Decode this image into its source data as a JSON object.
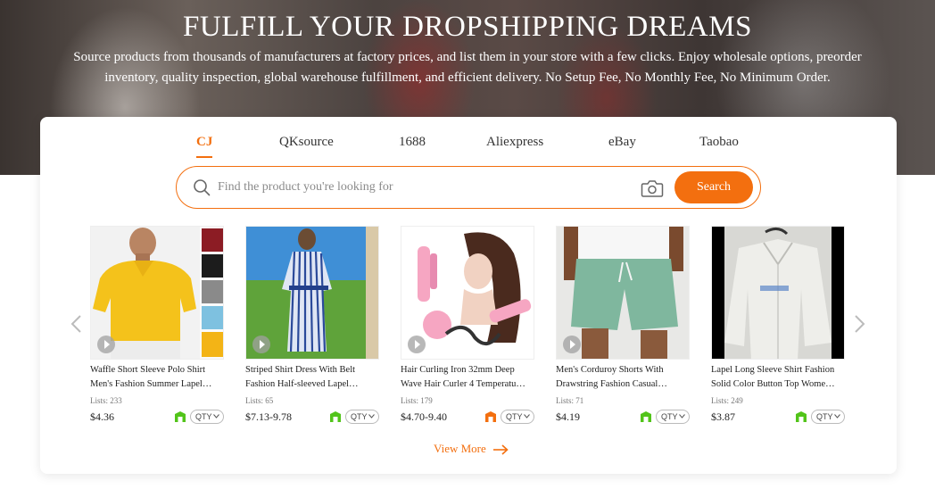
{
  "hero": {
    "title": "FULFILL YOUR DROPSHIPPING DREAMS",
    "subtitle_line1": "Source products from thousands of manufacturers at factory prices, and list them in your store with a few clicks. Enjoy wholesale options, preorder",
    "subtitle_line2": "inventory, quality inspection, global warehouse fulfillment, and efficient delivery. No Setup Fee, No Monthly Fee, No Minimum Order."
  },
  "tabs": [
    {
      "label": "CJ",
      "active": true
    },
    {
      "label": "QKsource",
      "active": false
    },
    {
      "label": "1688",
      "active": false
    },
    {
      "label": "Aliexpress",
      "active": false
    },
    {
      "label": "eBay",
      "active": false
    },
    {
      "label": "Taobao",
      "active": false
    }
  ],
  "search": {
    "placeholder": "Find the product you're looking for",
    "button_label": "Search"
  },
  "products": [
    {
      "title_line1": "Waffle Short Sleeve Polo Shirt",
      "title_line2": "Men's Fashion Summer Lapel…",
      "lists": "Lists: 233",
      "price": "$4.36",
      "stock_color": "#52c41a",
      "qty_label": "QTY"
    },
    {
      "title_line1": "Striped Shirt Dress With Belt",
      "title_line2": "Fashion Half-sleeved Lapel…",
      "lists": "Lists: 65",
      "price": "$7.13-9.78",
      "stock_color": "#52c41a",
      "qty_label": "QTY"
    },
    {
      "title_line1": "Hair Curling Iron 32mm Deep",
      "title_line2": "Wave Hair Curler 4 Temperatu…",
      "lists": "Lists: 179",
      "price": "$4.70-9.40",
      "stock_color": "#f36f0f",
      "qty_label": "QTY"
    },
    {
      "title_line1": "Men's Corduroy Shorts With",
      "title_line2": "Drawstring Fashion Casual…",
      "lists": "Lists: 71",
      "price": "$4.19",
      "stock_color": "#52c41a",
      "qty_label": "QTY"
    },
    {
      "title_line1": "Lapel Long Sleeve Shirt Fashion",
      "title_line2": "Solid Color Button Top Wome…",
      "lists": "Lists: 249",
      "price": "$3.87",
      "stock_color": "#52c41a",
      "qty_label": "QTY"
    }
  ],
  "view_more": "View More",
  "colors": {
    "accent": "#f36f0f",
    "stock_green": "#52c41a"
  }
}
